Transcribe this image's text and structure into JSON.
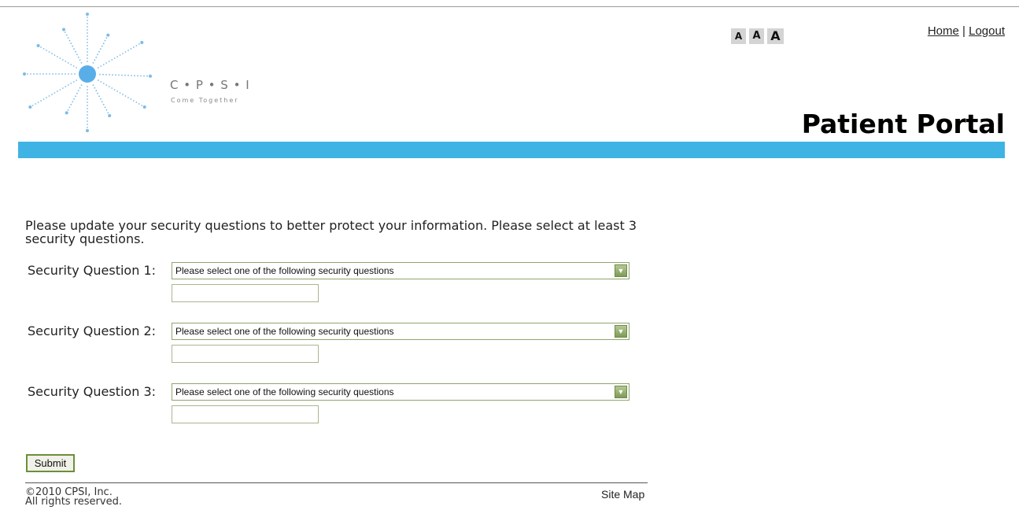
{
  "header": {
    "logo_text": "C • P • S • I",
    "logo_tagline": "Come Together",
    "font_sizer": {
      "small": "A",
      "medium": "A",
      "large": "A"
    },
    "links": {
      "home": "Home",
      "separator": "|",
      "logout": "Logout"
    },
    "portal_title": "Patient Portal",
    "banner_color": "#3fb4e4"
  },
  "main": {
    "intro": "Please update your security questions to better protect your information. Please select at least 3 security questions.",
    "questions": [
      {
        "label": "Security Question 1:",
        "selected": "Please select one of the following security questions",
        "answer": ""
      },
      {
        "label": "Security Question 2:",
        "selected": "Please select one of the following security questions",
        "answer": ""
      },
      {
        "label": "Security Question 3:",
        "selected": "Please select one of the following security questions",
        "answer": ""
      }
    ],
    "submit_label": "Submit"
  },
  "footer": {
    "copyright_line1": "©2010 CPSI, Inc.",
    "copyright_line2": "All rights reserved.",
    "site_map": "Site Map"
  },
  "colors": {
    "accent": "#3fb4e4",
    "logo_blue": "#5aaee8",
    "button_border": "#6b8f3a"
  },
  "icons": [
    "cpsi-logo-icon",
    "dropdown-arrow-icon"
  ]
}
